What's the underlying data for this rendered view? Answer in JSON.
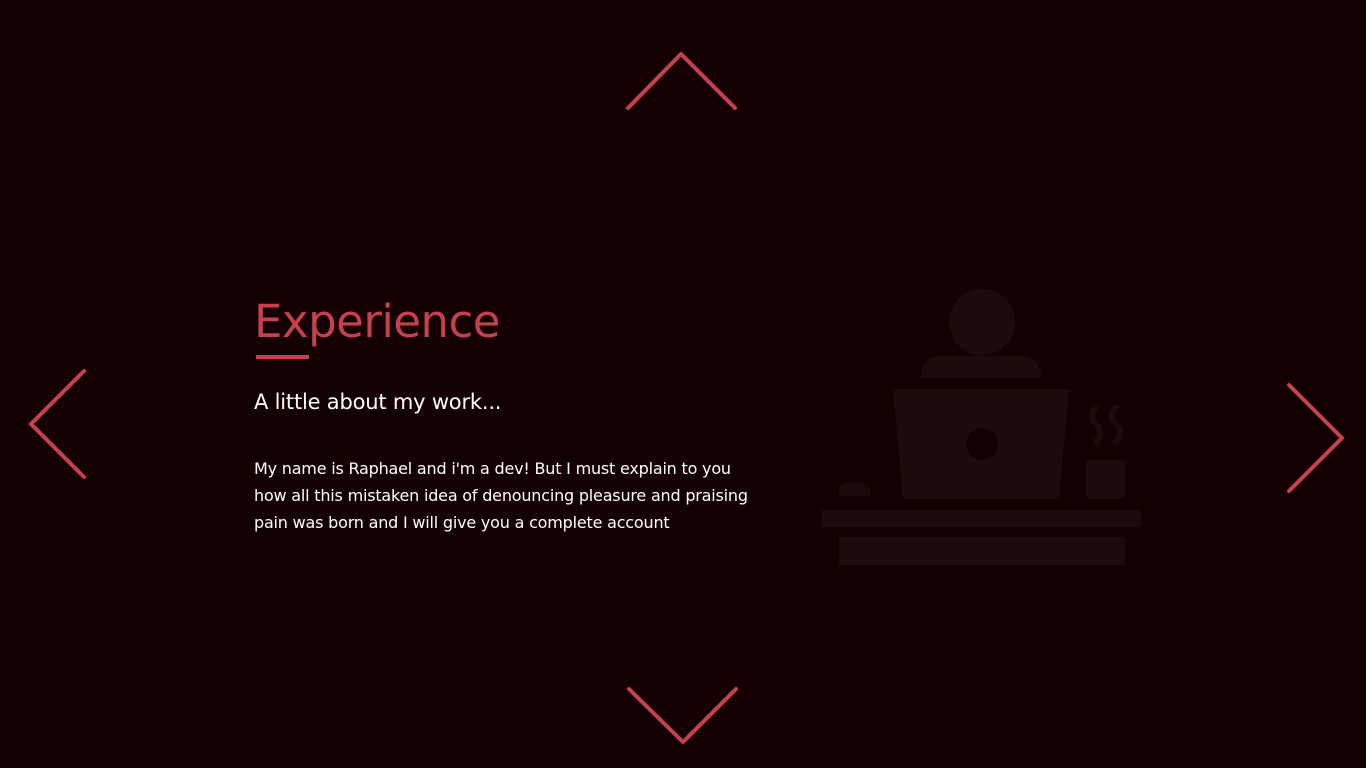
{
  "colors": {
    "background": "#140002",
    "accent": "#c6404d",
    "text": "#ffffff",
    "illustration": "#1c0b0d"
  },
  "navigation": {
    "up_icon": "chevron-up-icon",
    "down_icon": "chevron-down-icon",
    "left_icon": "chevron-left-icon",
    "right_icon": "chevron-right-icon"
  },
  "section": {
    "title": "Experience",
    "subtitle": "A little about my work...",
    "description": "My name is Raphael and i'm a dev! But I must explain to you how all this mistaken idea of denouncing pleasure and praising pain was born and I will give you a complete account"
  },
  "illustration": {
    "icon": "developer-at-laptop-icon"
  }
}
